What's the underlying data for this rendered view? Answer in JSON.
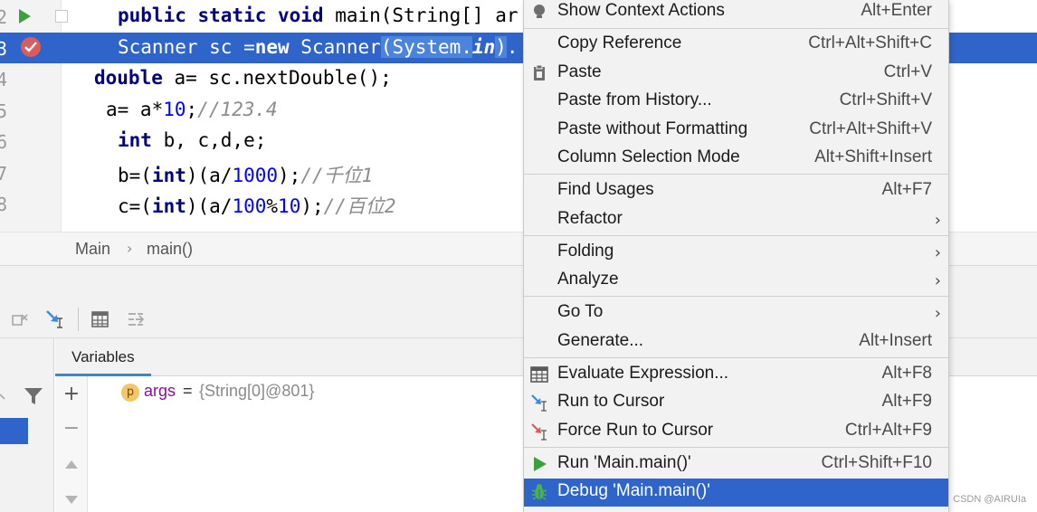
{
  "editor": {
    "line_numbers": [
      "2",
      "3",
      "4",
      "5",
      "6",
      "7",
      "8"
    ],
    "lines": [
      {
        "segments": [
          [
            "kw",
            "public static void "
          ],
          [
            "plain",
            "main(String[] ar"
          ]
        ]
      },
      {
        "segments": [
          [
            "plain",
            "Scanner sc ="
          ],
          [
            "kw",
            "new "
          ],
          [
            "plain",
            "Scanner"
          ],
          [
            "hl",
            "(System."
          ],
          [
            "fld",
            "in"
          ],
          [
            "hl",
            ")"
          ],
          [
            "plain",
            "."
          ]
        ]
      },
      {
        "segments": [
          [
            "kw",
            "double "
          ],
          [
            "plain",
            "a= sc.nextDouble();"
          ]
        ]
      },
      {
        "segments": [
          [
            "plain",
            "a= a*"
          ],
          [
            "num",
            "10"
          ],
          [
            "plain",
            ";"
          ],
          [
            "cmt",
            "//123.4"
          ]
        ]
      },
      {
        "segments": [
          [
            "kw",
            "int "
          ],
          [
            "plain",
            "b, c,d,e;"
          ]
        ]
      },
      {
        "segments": [
          [
            "plain",
            "b=("
          ],
          [
            "kw",
            "int"
          ],
          [
            "plain",
            ")(a/"
          ],
          [
            "num",
            "1000"
          ],
          [
            "plain",
            ");"
          ],
          [
            "cmt",
            "//千位1"
          ]
        ]
      },
      {
        "segments": [
          [
            "plain",
            "c=("
          ],
          [
            "kw",
            "int"
          ],
          [
            "plain",
            ")(a/"
          ],
          [
            "num",
            "100"
          ],
          [
            "plain",
            "%"
          ],
          [
            "num",
            "10"
          ],
          [
            "plain",
            ");"
          ],
          [
            "cmt",
            "//百位2"
          ]
        ]
      }
    ]
  },
  "breadcrumb": {
    "class_name": "Main",
    "method_name": "main()",
    "separator": "›"
  },
  "debug": {
    "variables_tab": "Variables",
    "variable": {
      "badge": "p",
      "name": "args",
      "equals": "=",
      "value": "{String[0]@801}"
    }
  },
  "context_menu": {
    "items": [
      {
        "label": "Show Context Actions",
        "shortcut": "Alt+Enter",
        "icon": "bulb-icon"
      },
      {
        "label": "Copy Reference",
        "shortcut": "Ctrl+Alt+Shift+C"
      },
      {
        "label": "Paste",
        "shortcut": "Ctrl+V",
        "icon": "clipboard-icon"
      },
      {
        "label": "Paste from History...",
        "shortcut": "Ctrl+Shift+V"
      },
      {
        "label": "Paste without Formatting",
        "shortcut": "Ctrl+Alt+Shift+V"
      },
      {
        "label": "Column Selection Mode",
        "shortcut": "Alt+Shift+Insert"
      },
      {
        "label": "Find Usages",
        "shortcut": "Alt+F7"
      },
      {
        "label": "Refactor",
        "submenu": true
      },
      {
        "label": "Folding",
        "submenu": true
      },
      {
        "label": "Analyze",
        "submenu": true
      },
      {
        "label": "Go To",
        "submenu": true
      },
      {
        "label": "Generate...",
        "shortcut": "Alt+Insert"
      },
      {
        "label": "Evaluate Expression...",
        "shortcut": "Alt+F8",
        "icon": "calculator-icon"
      },
      {
        "label": "Run to Cursor",
        "shortcut": "Alt+F9",
        "icon": "run-to-cursor-icon"
      },
      {
        "label": "Force Run to Cursor",
        "shortcut": "Ctrl+Alt+F9",
        "icon": "force-run-to-cursor-icon"
      },
      {
        "label": "Run 'Main.main()'",
        "shortcut": "Ctrl+Shift+F10",
        "icon": "run-icon"
      },
      {
        "label": "Debug 'Main.main()'",
        "shortcut": "",
        "icon": "debug-icon",
        "active": true
      }
    ],
    "submenu_arrow": "›"
  },
  "colors": {
    "selection": "#2f65ca",
    "keyword": "#000080",
    "number": "#0000ff",
    "comment": "#8c8c8c",
    "menu_bg": "#f2f2f2"
  },
  "watermark": "CSDN @AIRUIa"
}
